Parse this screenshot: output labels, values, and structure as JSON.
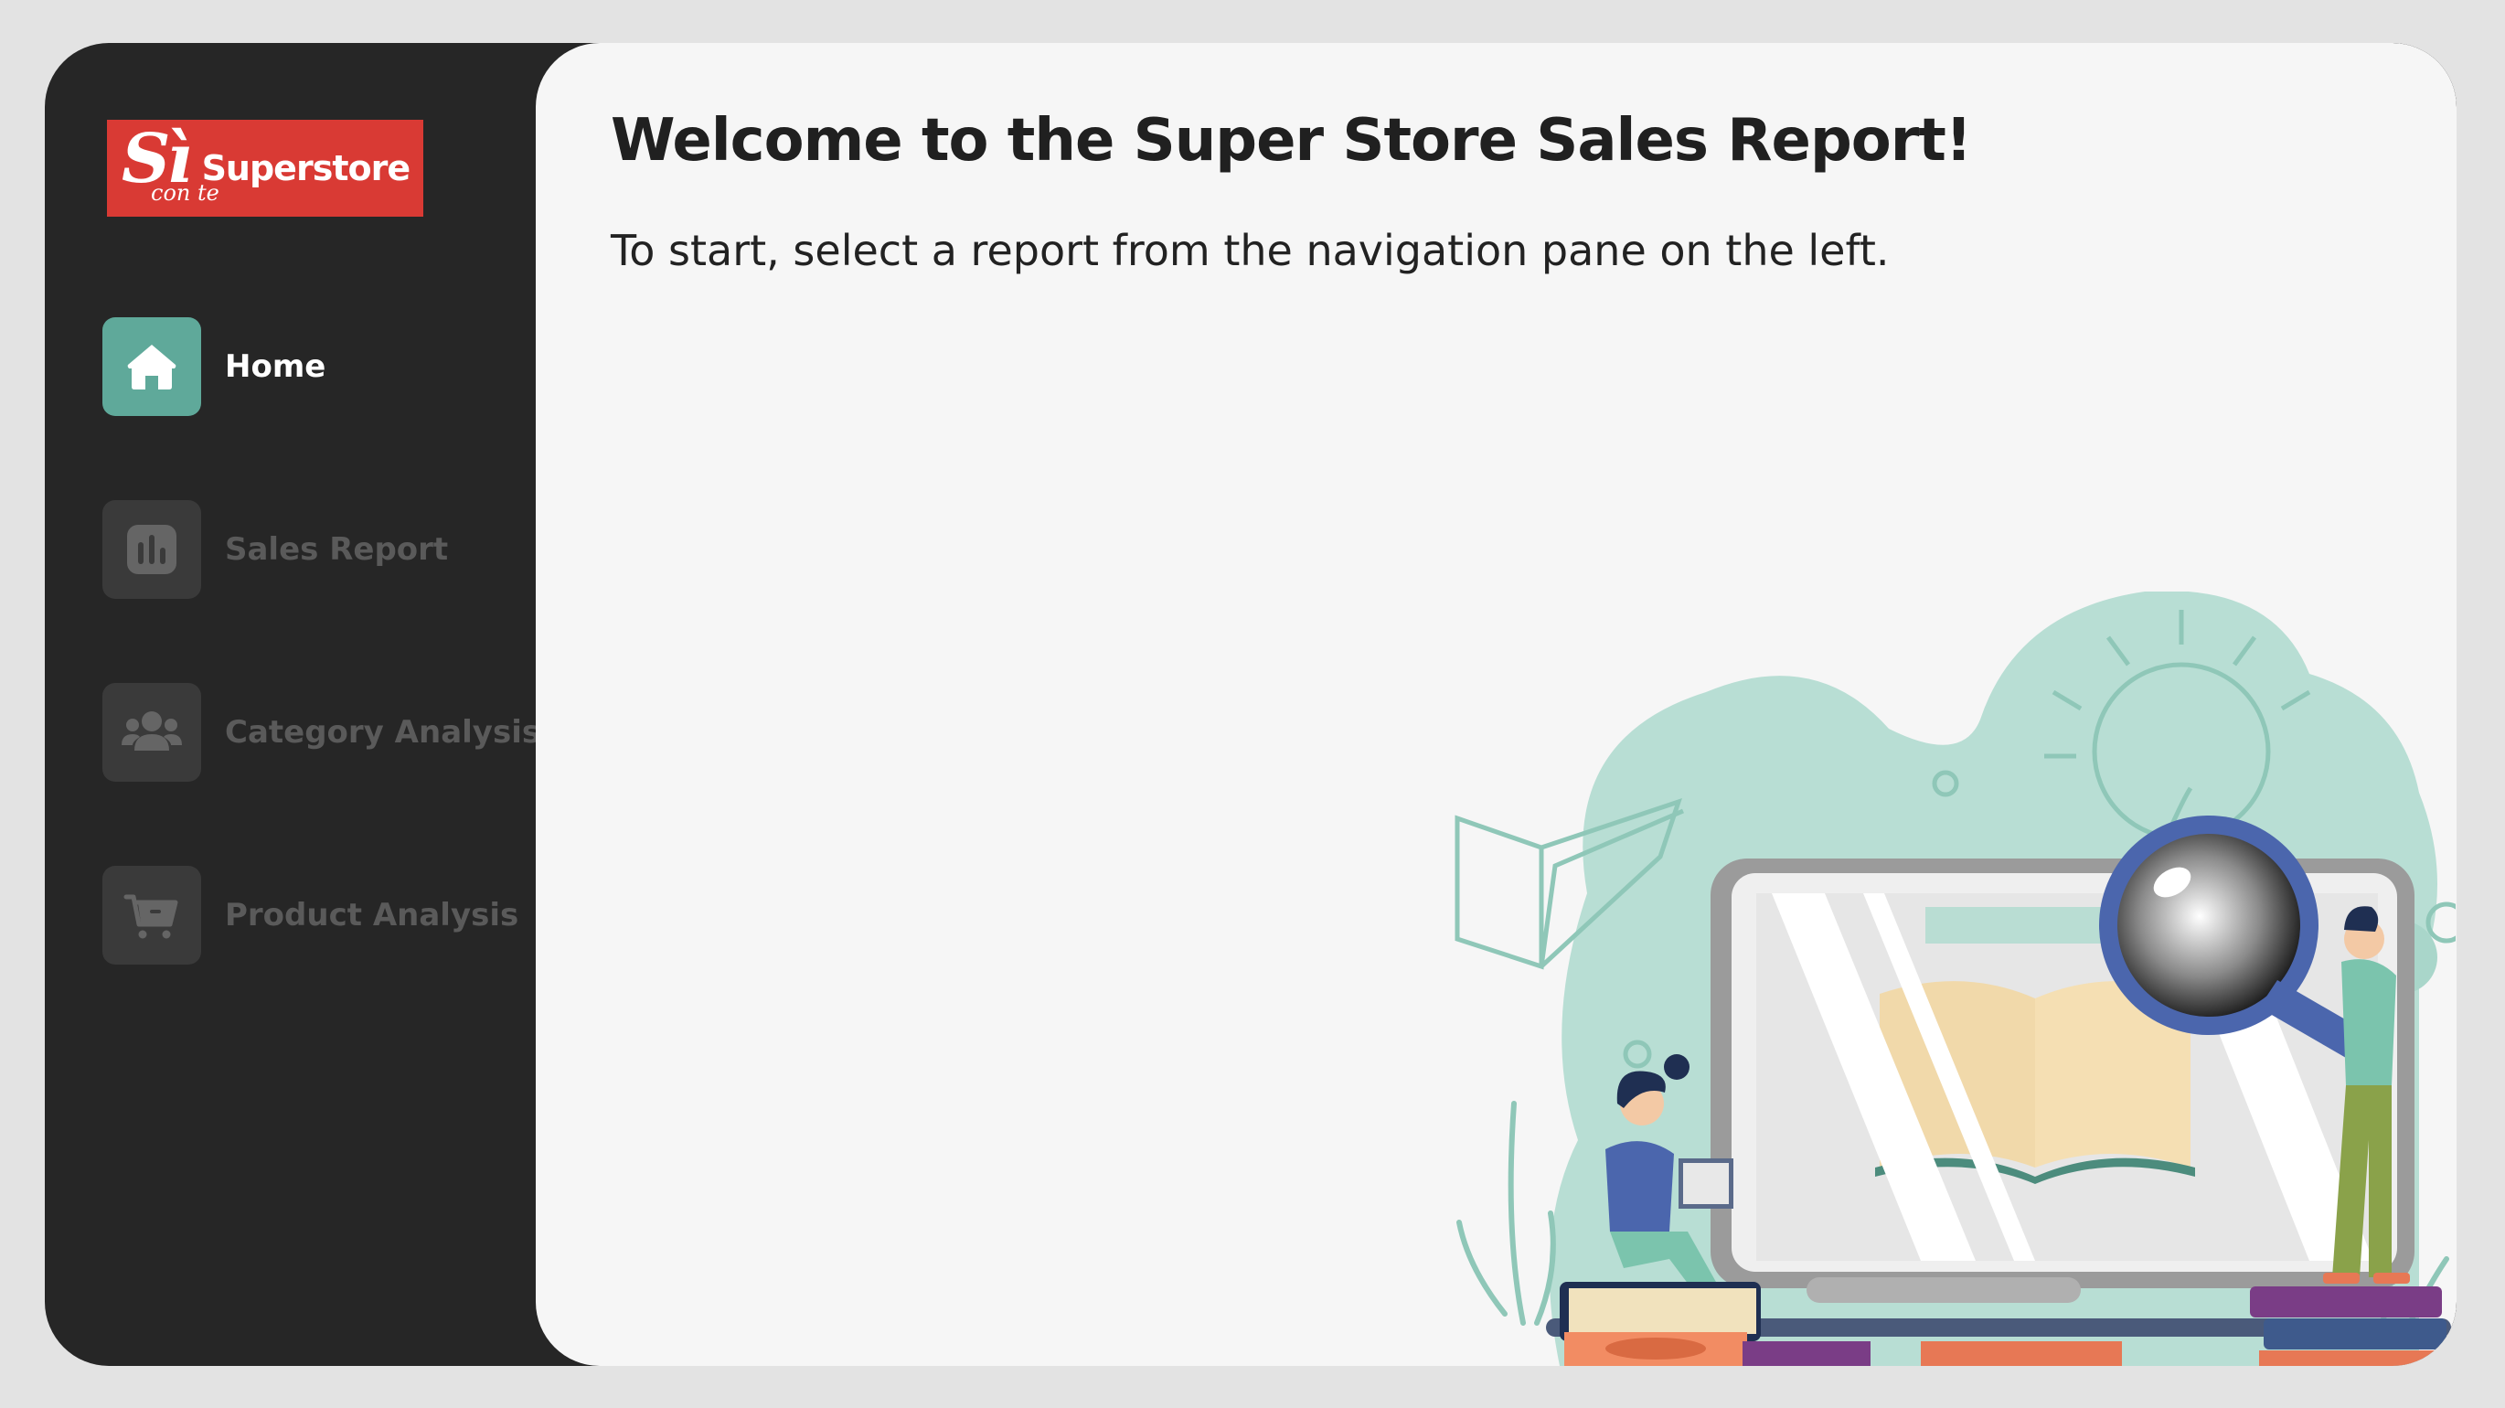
{
  "sidebar": {
    "logo": {
      "mark": "Sì",
      "sub": "con te",
      "brand": "Superstore"
    },
    "items": [
      {
        "label": "Home",
        "icon": "home-icon",
        "active": true
      },
      {
        "label": "Sales Report",
        "icon": "bar-chart-icon",
        "active": false
      },
      {
        "label": "Category Analysis",
        "icon": "users-icon",
        "active": false
      },
      {
        "label": "Product Analysis",
        "icon": "cart-icon",
        "active": false
      }
    ]
  },
  "main": {
    "title": "Welcome to the Super Store Sales Report!",
    "subtitle": "To start, select a report from the navigation pane on the left."
  },
  "colors": {
    "sidebar_bg": "#262626",
    "accent": "#5fa99a",
    "logo_red": "#d93a34",
    "page_bg": "#f6f6f6",
    "inactive_text": "#5a5a5a"
  }
}
